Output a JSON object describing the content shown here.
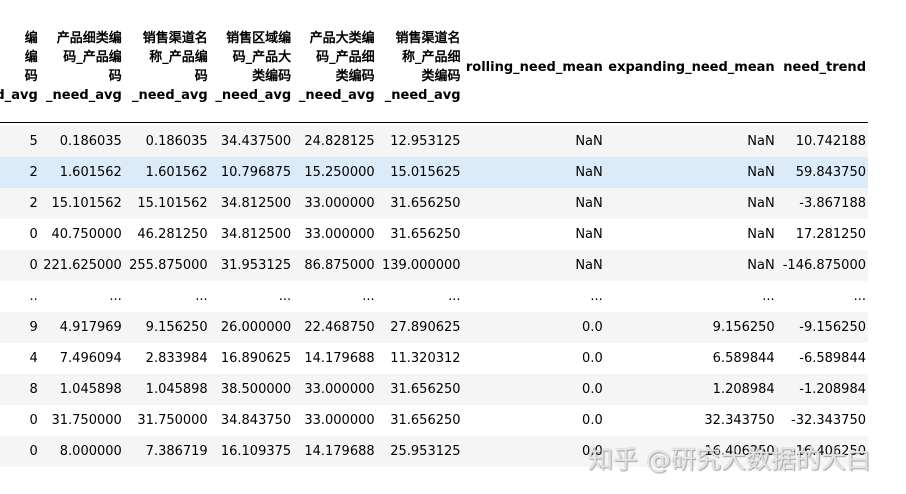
{
  "table": {
    "columns": [
      "编\n编\n码\n_need_avg",
      "产品细类编\n码_产品编\n码\n_need_avg",
      "销售渠道名\n称_产品编\n码\n_need_avg",
      "销售区域编\n码_产品大\n类编码\n_need_avg",
      "产品大类编\n码_产品细\n类编码\n_need_avg",
      "销售渠道名\n称_产品细\n类编码\n_need_avg",
      "rolling_need_mean",
      "expanding_need_mean",
      "need_trend"
    ],
    "rows": [
      [
        "5",
        "0.186035",
        "0.186035",
        "34.437500",
        "24.828125",
        "12.953125",
        "NaN",
        "NaN",
        "10.742188"
      ],
      [
        "2",
        "1.601562",
        "1.601562",
        "10.796875",
        "15.250000",
        "15.015625",
        "NaN",
        "NaN",
        "59.843750"
      ],
      [
        "2",
        "15.101562",
        "15.101562",
        "34.812500",
        "33.000000",
        "31.656250",
        "NaN",
        "NaN",
        "-3.867188"
      ],
      [
        "0",
        "40.750000",
        "46.281250",
        "34.812500",
        "33.000000",
        "31.656250",
        "NaN",
        "NaN",
        "17.281250"
      ],
      [
        "0",
        "221.625000",
        "255.875000",
        "31.953125",
        "86.875000",
        "139.000000",
        "NaN",
        "NaN",
        "-146.875000"
      ],
      [
        "..",
        "...",
        "...",
        "...",
        "...",
        "...",
        "...",
        "...",
        "..."
      ],
      [
        "9",
        "4.917969",
        "9.156250",
        "26.000000",
        "22.468750",
        "27.890625",
        "0.0",
        "9.156250",
        "-9.156250"
      ],
      [
        "4",
        "7.496094",
        "2.833984",
        "16.890625",
        "14.179688",
        "11.320312",
        "0.0",
        "6.589844",
        "-6.589844"
      ],
      [
        "8",
        "1.045898",
        "1.045898",
        "38.500000",
        "33.000000",
        "31.656250",
        "0.0",
        "1.208984",
        "-1.208984"
      ],
      [
        "0",
        "31.750000",
        "31.750000",
        "34.843750",
        "33.000000",
        "31.656250",
        "0.0",
        "32.343750",
        "-32.343750"
      ],
      [
        "0",
        "8.000000",
        "7.386719",
        "16.109375",
        "14.179688",
        "25.953125",
        "0.0",
        "16.406250",
        "-16.406250"
      ]
    ],
    "highlighted_row_index": 1
  },
  "watermark": {
    "text": "知乎 @研究大数据的大白"
  }
}
